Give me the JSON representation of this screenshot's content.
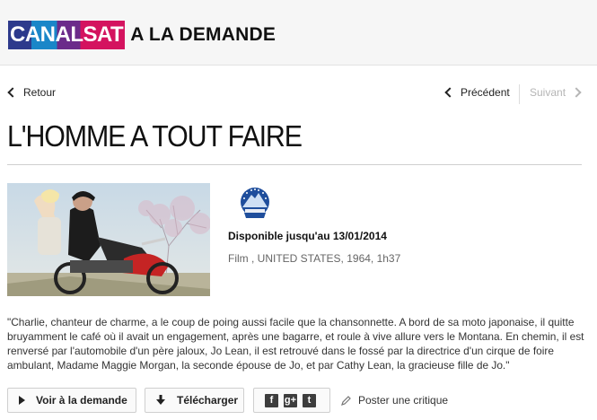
{
  "header": {
    "brand": "CANALSAT",
    "suffix": "A LA DEMANDE"
  },
  "nav": {
    "back_label": "Retour",
    "prev_label": "Précédent",
    "next_label": "Suivant"
  },
  "page": {
    "title": "L'HOMME A TOUT FAIRE"
  },
  "film": {
    "channel": "Paramount Channel",
    "availability": "Disponible jusqu'au 13/01/2014",
    "meta": "Film , UNITED STATES, 1964, 1h37",
    "synopsis": "\"Charlie, chanteur de charme, a le coup de poing aussi facile que la chansonnette. A bord de sa moto japonaise, il quitte bruyamment le café où il avait un engagement, après une bagarre, et roule à vive allure vers le Montana. En chemin, il est renversé par l'automobile d'un père jaloux, Jo Lean, il est retrouvé dans le fossé par la directrice d'un cirque de foire ambulant, Madame Maggie Morgan, la seconde épouse de Jo, et par Cathy Lean, la gracieuse fille de Jo.\""
  },
  "actions": {
    "watch_label": "Voir à la demande",
    "download_label": "Télécharger",
    "review_label": "Poster une critique",
    "social": [
      "f",
      "g+",
      "t"
    ]
  },
  "colors": {
    "brand_navy": "#2d3a8c",
    "brand_blue": "#1a86c8",
    "brand_purple": "#6b2b8a",
    "brand_pink": "#d4135f",
    "disabled_text": "#b5b5b5"
  }
}
